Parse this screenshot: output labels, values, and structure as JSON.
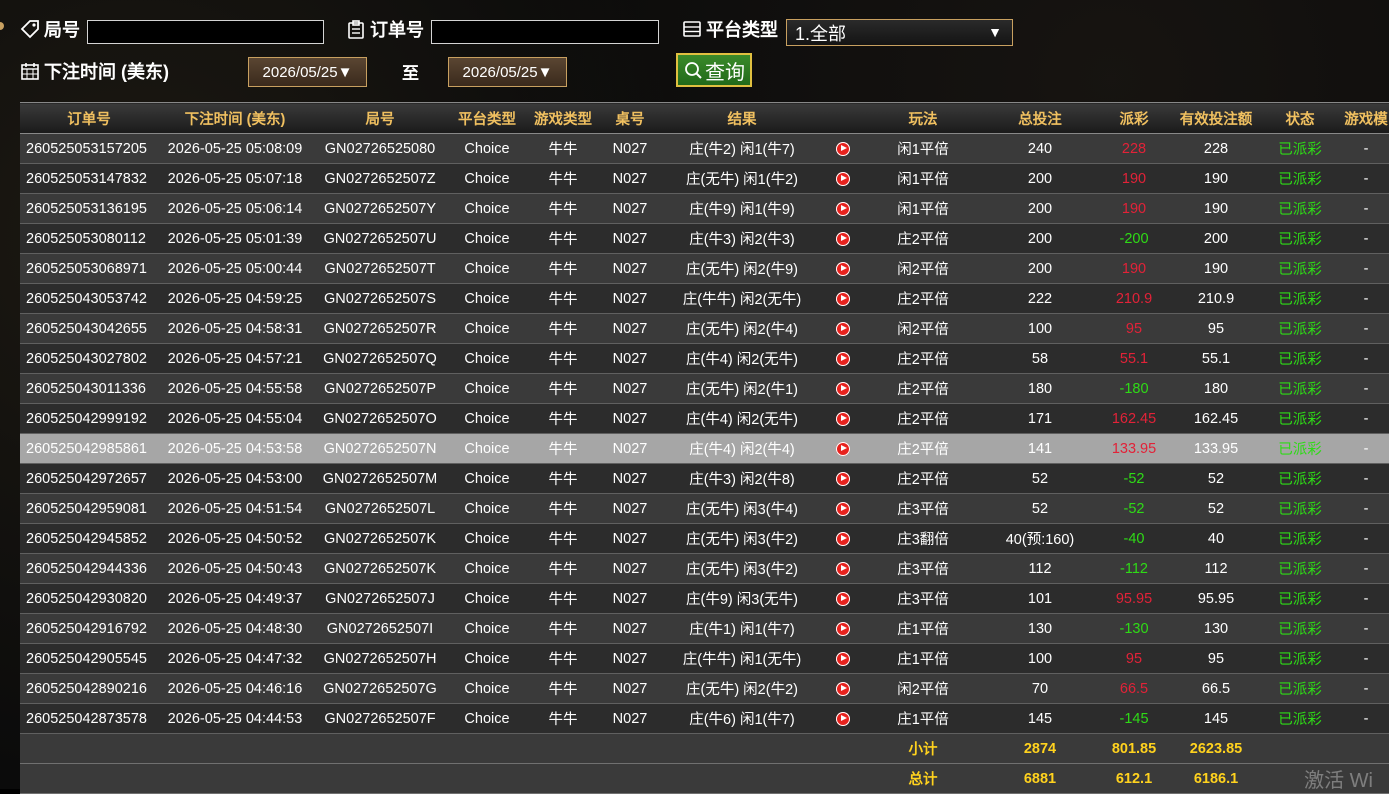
{
  "filters": {
    "round_label": "局号",
    "round_value": "",
    "order_label": "订单号",
    "order_value": "",
    "platform_label": "平台类型",
    "platform_selected": "1.全部",
    "bet_time_label": "下注时间 (美东)",
    "date_from": "2026/05/25▼",
    "to_label": "至",
    "date_to": "2026/05/25▼",
    "query_label": "查询"
  },
  "table": {
    "columns": [
      "订单号",
      "下注时间 (美东)",
      "局号",
      "平台类型",
      "游戏类型",
      "桌号",
      "结果",
      "玩法",
      "总投注",
      "派彩",
      "有效投注额",
      "状态",
      "游戏模"
    ],
    "rows": [
      {
        "order": "260525053157205",
        "time": "2026-05-25 05:08:09",
        "round": "GN02726525080",
        "platform": "Choice",
        "game": "牛牛",
        "table": "N027",
        "result": "庄(牛2) 闲1(牛7)",
        "play": "闲1平倍",
        "bet": "240",
        "payout": "228",
        "payout_tone": "red",
        "valid": "228",
        "status": "已派彩",
        "mode": "-"
      },
      {
        "order": "260525053147832",
        "time": "2026-05-25 05:07:18",
        "round": "GN0272652507Z",
        "platform": "Choice",
        "game": "牛牛",
        "table": "N027",
        "result": "庄(无牛) 闲1(牛2)",
        "play": "闲1平倍",
        "bet": "200",
        "payout": "190",
        "payout_tone": "red",
        "valid": "190",
        "status": "已派彩",
        "mode": "-"
      },
      {
        "order": "260525053136195",
        "time": "2026-05-25 05:06:14",
        "round": "GN0272652507Y",
        "platform": "Choice",
        "game": "牛牛",
        "table": "N027",
        "result": "庄(牛9) 闲1(牛9)",
        "play": "闲1平倍",
        "bet": "200",
        "payout": "190",
        "payout_tone": "red",
        "valid": "190",
        "status": "已派彩",
        "mode": "-"
      },
      {
        "order": "260525053080112",
        "time": "2026-05-25 05:01:39",
        "round": "GN0272652507U",
        "platform": "Choice",
        "game": "牛牛",
        "table": "N027",
        "result": "庄(牛3) 闲2(牛3)",
        "play": "庄2平倍",
        "bet": "200",
        "payout": "-200",
        "payout_tone": "green",
        "valid": "200",
        "status": "已派彩",
        "mode": "-"
      },
      {
        "order": "260525053068971",
        "time": "2026-05-25 05:00:44",
        "round": "GN0272652507T",
        "platform": "Choice",
        "game": "牛牛",
        "table": "N027",
        "result": "庄(无牛) 闲2(牛9)",
        "play": "闲2平倍",
        "bet": "200",
        "payout": "190",
        "payout_tone": "red",
        "valid": "190",
        "status": "已派彩",
        "mode": "-"
      },
      {
        "order": "260525043053742",
        "time": "2026-05-25 04:59:25",
        "round": "GN0272652507S",
        "platform": "Choice",
        "game": "牛牛",
        "table": "N027",
        "result": "庄(牛牛) 闲2(无牛)",
        "play": "庄2平倍",
        "bet": "222",
        "payout": "210.9",
        "payout_tone": "red",
        "valid": "210.9",
        "status": "已派彩",
        "mode": "-"
      },
      {
        "order": "260525043042655",
        "time": "2026-05-25 04:58:31",
        "round": "GN0272652507R",
        "platform": "Choice",
        "game": "牛牛",
        "table": "N027",
        "result": "庄(无牛) 闲2(牛4)",
        "play": "闲2平倍",
        "bet": "100",
        "payout": "95",
        "payout_tone": "red",
        "valid": "95",
        "status": "已派彩",
        "mode": "-"
      },
      {
        "order": "260525043027802",
        "time": "2026-05-25 04:57:21",
        "round": "GN0272652507Q",
        "platform": "Choice",
        "game": "牛牛",
        "table": "N027",
        "result": "庄(牛4) 闲2(无牛)",
        "play": "庄2平倍",
        "bet": "58",
        "payout": "55.1",
        "payout_tone": "red",
        "valid": "55.1",
        "status": "已派彩",
        "mode": "-"
      },
      {
        "order": "260525043011336",
        "time": "2026-05-25 04:55:58",
        "round": "GN0272652507P",
        "platform": "Choice",
        "game": "牛牛",
        "table": "N027",
        "result": "庄(无牛) 闲2(牛1)",
        "play": "庄2平倍",
        "bet": "180",
        "payout": "-180",
        "payout_tone": "green",
        "valid": "180",
        "status": "已派彩",
        "mode": "-"
      },
      {
        "order": "260525042999192",
        "time": "2026-05-25 04:55:04",
        "round": "GN0272652507O",
        "platform": "Choice",
        "game": "牛牛",
        "table": "N027",
        "result": "庄(牛4) 闲2(无牛)",
        "play": "庄2平倍",
        "bet": "171",
        "payout": "162.45",
        "payout_tone": "red",
        "valid": "162.45",
        "status": "已派彩",
        "mode": "-"
      },
      {
        "order": "260525042985861",
        "time": "2026-05-25 04:53:58",
        "round": "GN0272652507N",
        "platform": "Choice",
        "game": "牛牛",
        "table": "N027",
        "result": "庄(牛4) 闲2(牛4)",
        "play": "庄2平倍",
        "bet": "141",
        "payout": "133.95",
        "payout_tone": "red",
        "valid": "133.95",
        "status": "已派彩",
        "mode": "-",
        "selected": true
      },
      {
        "order": "260525042972657",
        "time": "2026-05-25 04:53:00",
        "round": "GN0272652507M",
        "platform": "Choice",
        "game": "牛牛",
        "table": "N027",
        "result": "庄(牛3) 闲2(牛8)",
        "play": "庄2平倍",
        "bet": "52",
        "payout": "-52",
        "payout_tone": "green",
        "valid": "52",
        "status": "已派彩",
        "mode": "-"
      },
      {
        "order": "260525042959081",
        "time": "2026-05-25 04:51:54",
        "round": "GN0272652507L",
        "platform": "Choice",
        "game": "牛牛",
        "table": "N027",
        "result": "庄(无牛) 闲3(牛4)",
        "play": "庄3平倍",
        "bet": "52",
        "payout": "-52",
        "payout_tone": "green",
        "valid": "52",
        "status": "已派彩",
        "mode": "-"
      },
      {
        "order": "260525042945852",
        "time": "2026-05-25 04:50:52",
        "round": "GN0272652507K",
        "platform": "Choice",
        "game": "牛牛",
        "table": "N027",
        "result": "庄(无牛) 闲3(牛2)",
        "play": "庄3翻倍",
        "bet": "40(预:160)",
        "payout": "-40",
        "payout_tone": "green",
        "valid": "40",
        "status": "已派彩",
        "mode": "-"
      },
      {
        "order": "260525042944336",
        "time": "2026-05-25 04:50:43",
        "round": "GN0272652507K",
        "platform": "Choice",
        "game": "牛牛",
        "table": "N027",
        "result": "庄(无牛) 闲3(牛2)",
        "play": "庄3平倍",
        "bet": "112",
        "payout": "-112",
        "payout_tone": "green",
        "valid": "112",
        "status": "已派彩",
        "mode": "-"
      },
      {
        "order": "260525042930820",
        "time": "2026-05-25 04:49:37",
        "round": "GN0272652507J",
        "platform": "Choice",
        "game": "牛牛",
        "table": "N027",
        "result": "庄(牛9) 闲3(无牛)",
        "play": "庄3平倍",
        "bet": "101",
        "payout": "95.95",
        "payout_tone": "red",
        "valid": "95.95",
        "status": "已派彩",
        "mode": "-"
      },
      {
        "order": "260525042916792",
        "time": "2026-05-25 04:48:30",
        "round": "GN0272652507I",
        "platform": "Choice",
        "game": "牛牛",
        "table": "N027",
        "result": "庄(牛1) 闲1(牛7)",
        "play": "庄1平倍",
        "bet": "130",
        "payout": "-130",
        "payout_tone": "green",
        "valid": "130",
        "status": "已派彩",
        "mode": "-"
      },
      {
        "order": "260525042905545",
        "time": "2026-05-25 04:47:32",
        "round": "GN0272652507H",
        "platform": "Choice",
        "game": "牛牛",
        "table": "N027",
        "result": "庄(牛牛) 闲1(无牛)",
        "play": "庄1平倍",
        "bet": "100",
        "payout": "95",
        "payout_tone": "red",
        "valid": "95",
        "status": "已派彩",
        "mode": "-"
      },
      {
        "order": "260525042890216",
        "time": "2026-05-25 04:46:16",
        "round": "GN0272652507G",
        "platform": "Choice",
        "game": "牛牛",
        "table": "N027",
        "result": "庄(无牛) 闲2(牛2)",
        "play": "闲2平倍",
        "bet": "70",
        "payout": "66.5",
        "payout_tone": "red",
        "valid": "66.5",
        "status": "已派彩",
        "mode": "-"
      },
      {
        "order": "260525042873578",
        "time": "2026-05-25 04:44:53",
        "round": "GN0272652507F",
        "platform": "Choice",
        "game": "牛牛",
        "table": "N027",
        "result": "庄(牛6) 闲1(牛7)",
        "play": "庄1平倍",
        "bet": "145",
        "payout": "-145",
        "payout_tone": "green",
        "valid": "145",
        "status": "已派彩",
        "mode": "-"
      }
    ],
    "subtotal": {
      "label": "小计",
      "bet": "2874",
      "payout": "801.85",
      "valid": "2623.85"
    },
    "total": {
      "label": "总计",
      "bet": "6881",
      "payout": "612.1",
      "valid": "6186.1"
    }
  },
  "watermark": "激活 Wi",
  "colors": {
    "header_text": "#f0c060",
    "win_red": "#e22238",
    "loss_green": "#2edb16",
    "footer_yellow": "#ffd21e"
  }
}
